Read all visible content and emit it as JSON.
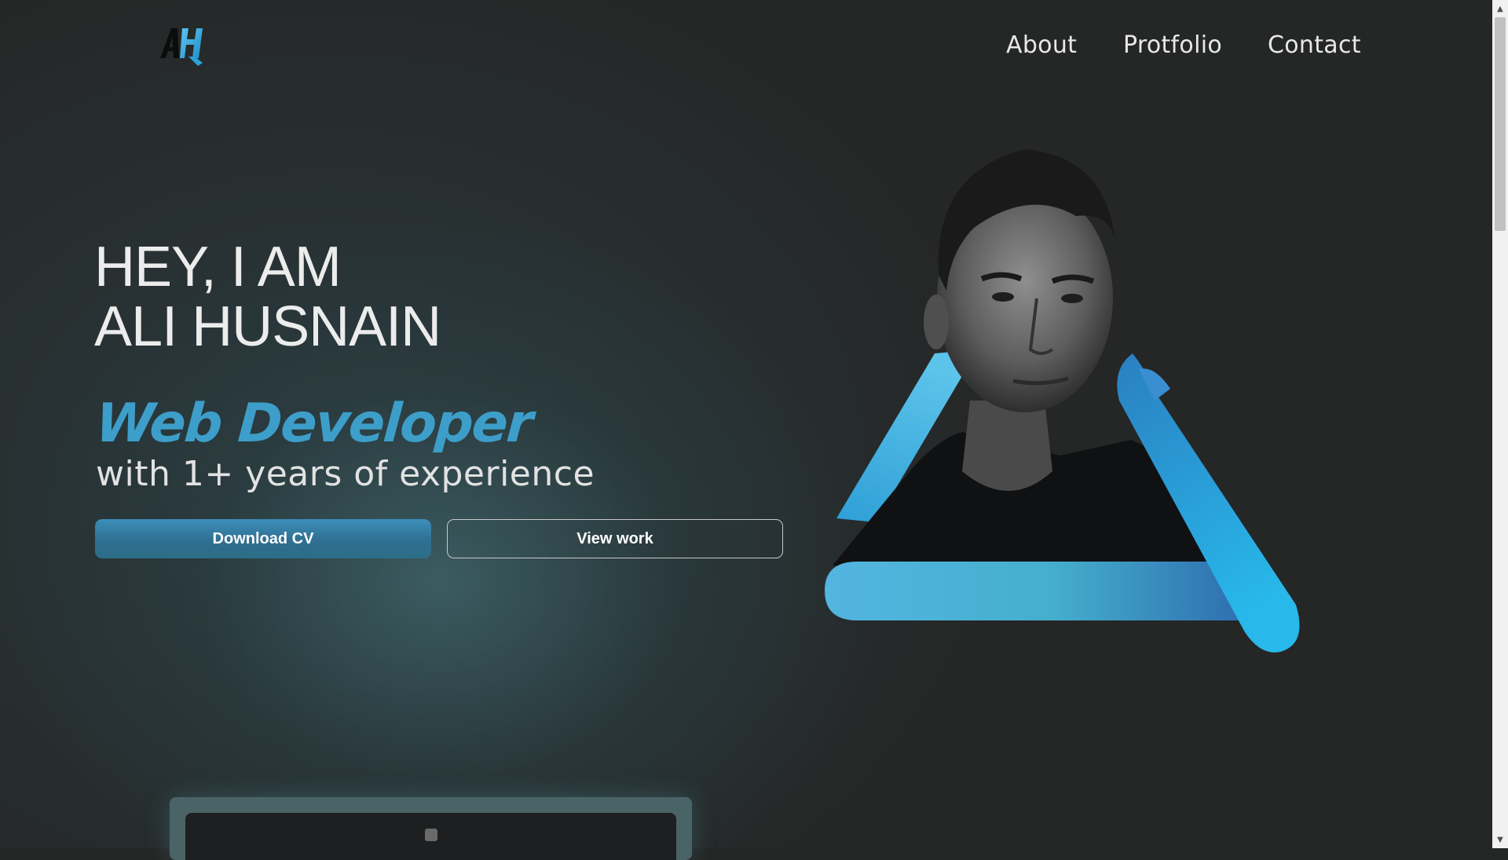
{
  "header": {
    "logo_alt": "AH",
    "nav": {
      "about": "About",
      "portfolio": "Protfolio",
      "contact": "Contact"
    }
  },
  "hero": {
    "greeting_line1": "HEY, I AM",
    "greeting_line2": "ALI HUSNAIN",
    "role": "Web Developer",
    "experience": "with 1+ years of experience",
    "download_cv_label": "Download CV",
    "view_work_label": "View work"
  },
  "colors": {
    "background": "#252626",
    "accent": "#3d9ec9",
    "accent_light": "#2fb6e8",
    "text": "#ececec"
  },
  "icons": {
    "logo": "ah-monogram-logo",
    "scroll_up": "scroll-up-arrow-icon",
    "scroll_down": "scroll-down-arrow-icon"
  }
}
